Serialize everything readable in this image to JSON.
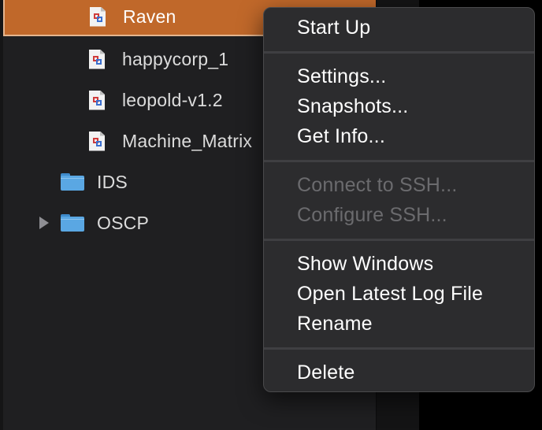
{
  "sidebar": {
    "vms": [
      {
        "label": "Raven",
        "selected": true
      },
      {
        "label": "happycorp_1",
        "selected": false
      },
      {
        "label": "leopold-v1.2",
        "selected": false
      },
      {
        "label": "Machine_Matrix",
        "selected": false
      }
    ],
    "folders": [
      {
        "label": "IDS",
        "expandable": false
      },
      {
        "label": "OSCP",
        "expandable": true
      }
    ]
  },
  "context_menu": {
    "start_up": "Start Up",
    "settings": "Settings...",
    "snapshots": "Snapshots...",
    "get_info": "Get Info...",
    "connect_ssh": "Connect to SSH...",
    "configure_ssh": "Configure SSH...",
    "show_windows": "Show Windows",
    "open_log": "Open Latest Log File",
    "rename": "Rename",
    "delete": "Delete"
  },
  "colors": {
    "selection": "#c0682a",
    "folder": "#5aa7e3",
    "menu_bg": "#2c2c2e",
    "disabled_text": "#6b6b6e"
  }
}
